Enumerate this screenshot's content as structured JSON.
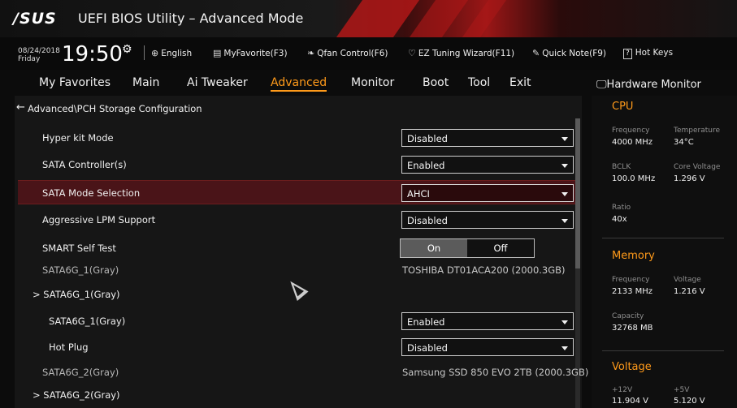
{
  "app": {
    "logo": "/SUS",
    "title": "UEFI BIOS Utility – Advanced Mode"
  },
  "infobar": {
    "date": "08/24/2018",
    "day": "Friday",
    "time": "19:50",
    "items": [
      {
        "icon": "globe-icon",
        "label": "English"
      },
      {
        "icon": "favorite-icon",
        "label": "MyFavorite(F3)"
      },
      {
        "icon": "fan-icon",
        "label": "Qfan Control(F6)"
      },
      {
        "icon": "bulb-icon",
        "label": "EZ Tuning Wizard(F11)"
      },
      {
        "icon": "note-icon",
        "label": "Quick Note(F9)"
      },
      {
        "icon": "question-icon",
        "label": "Hot Keys"
      }
    ]
  },
  "menu": [
    "My Favorites",
    "Main",
    "Ai Tweaker",
    "Advanced",
    "Monitor",
    "Boot",
    "Tool",
    "Exit"
  ],
  "active_menu": "Advanced",
  "breadcrumb": "Advanced\\PCH Storage Configuration",
  "settings": {
    "hyper_kit": {
      "label": "Hyper kit Mode",
      "value": "Disabled"
    },
    "sata_controller": {
      "label": "SATA Controller(s)",
      "value": "Enabled"
    },
    "sata_mode": {
      "label": "SATA Mode Selection",
      "value": "AHCI"
    },
    "alpm": {
      "label": "Aggressive LPM Support",
      "value": "Disabled"
    },
    "smart": {
      "label": "SMART Self Test",
      "on": "On",
      "off": "Off",
      "selected": "On"
    },
    "sata1_info": {
      "label": "SATA6G_1(Gray)",
      "value": "TOSHIBA DT01ACA200 (2000.3GB)"
    },
    "sata1_sub": {
      "label": "SATA6G_1(Gray)"
    },
    "sata1_enable": {
      "label": "SATA6G_1(Gray)",
      "value": "Enabled"
    },
    "hot_plug": {
      "label": "Hot Plug",
      "value": "Disabled"
    },
    "sata2_info": {
      "label": "SATA6G_2(Gray)",
      "value": "Samsung SSD 850 EVO 2TB (2000.3GB)"
    },
    "sata2_sub": {
      "label": "SATA6G_2(Gray)"
    }
  },
  "hw": {
    "title": "Hardware Monitor",
    "cpu": {
      "heading": "CPU",
      "freq_label": "Frequency",
      "freq": "4000 MHz",
      "temp_label": "Temperature",
      "temp": "34°C",
      "bclk_label": "BCLK",
      "bclk": "100.0 MHz",
      "cv_label": "Core Voltage",
      "cv": "1.296 V",
      "ratio_label": "Ratio",
      "ratio": "40x"
    },
    "memory": {
      "heading": "Memory",
      "freq_label": "Frequency",
      "freq": "2133 MHz",
      "volt_label": "Voltage",
      "volt": "1.216 V",
      "cap_label": "Capacity",
      "cap": "32768 MB"
    },
    "voltage": {
      "heading": "Voltage",
      "v12_label": "+12V",
      "v12": "11.904 V",
      "v5_label": "+5V",
      "v5": "5.120 V"
    }
  },
  "colors": {
    "accent": "#ff9a1a",
    "highlight": "#4a1418",
    "brand_red": "#b01818"
  }
}
